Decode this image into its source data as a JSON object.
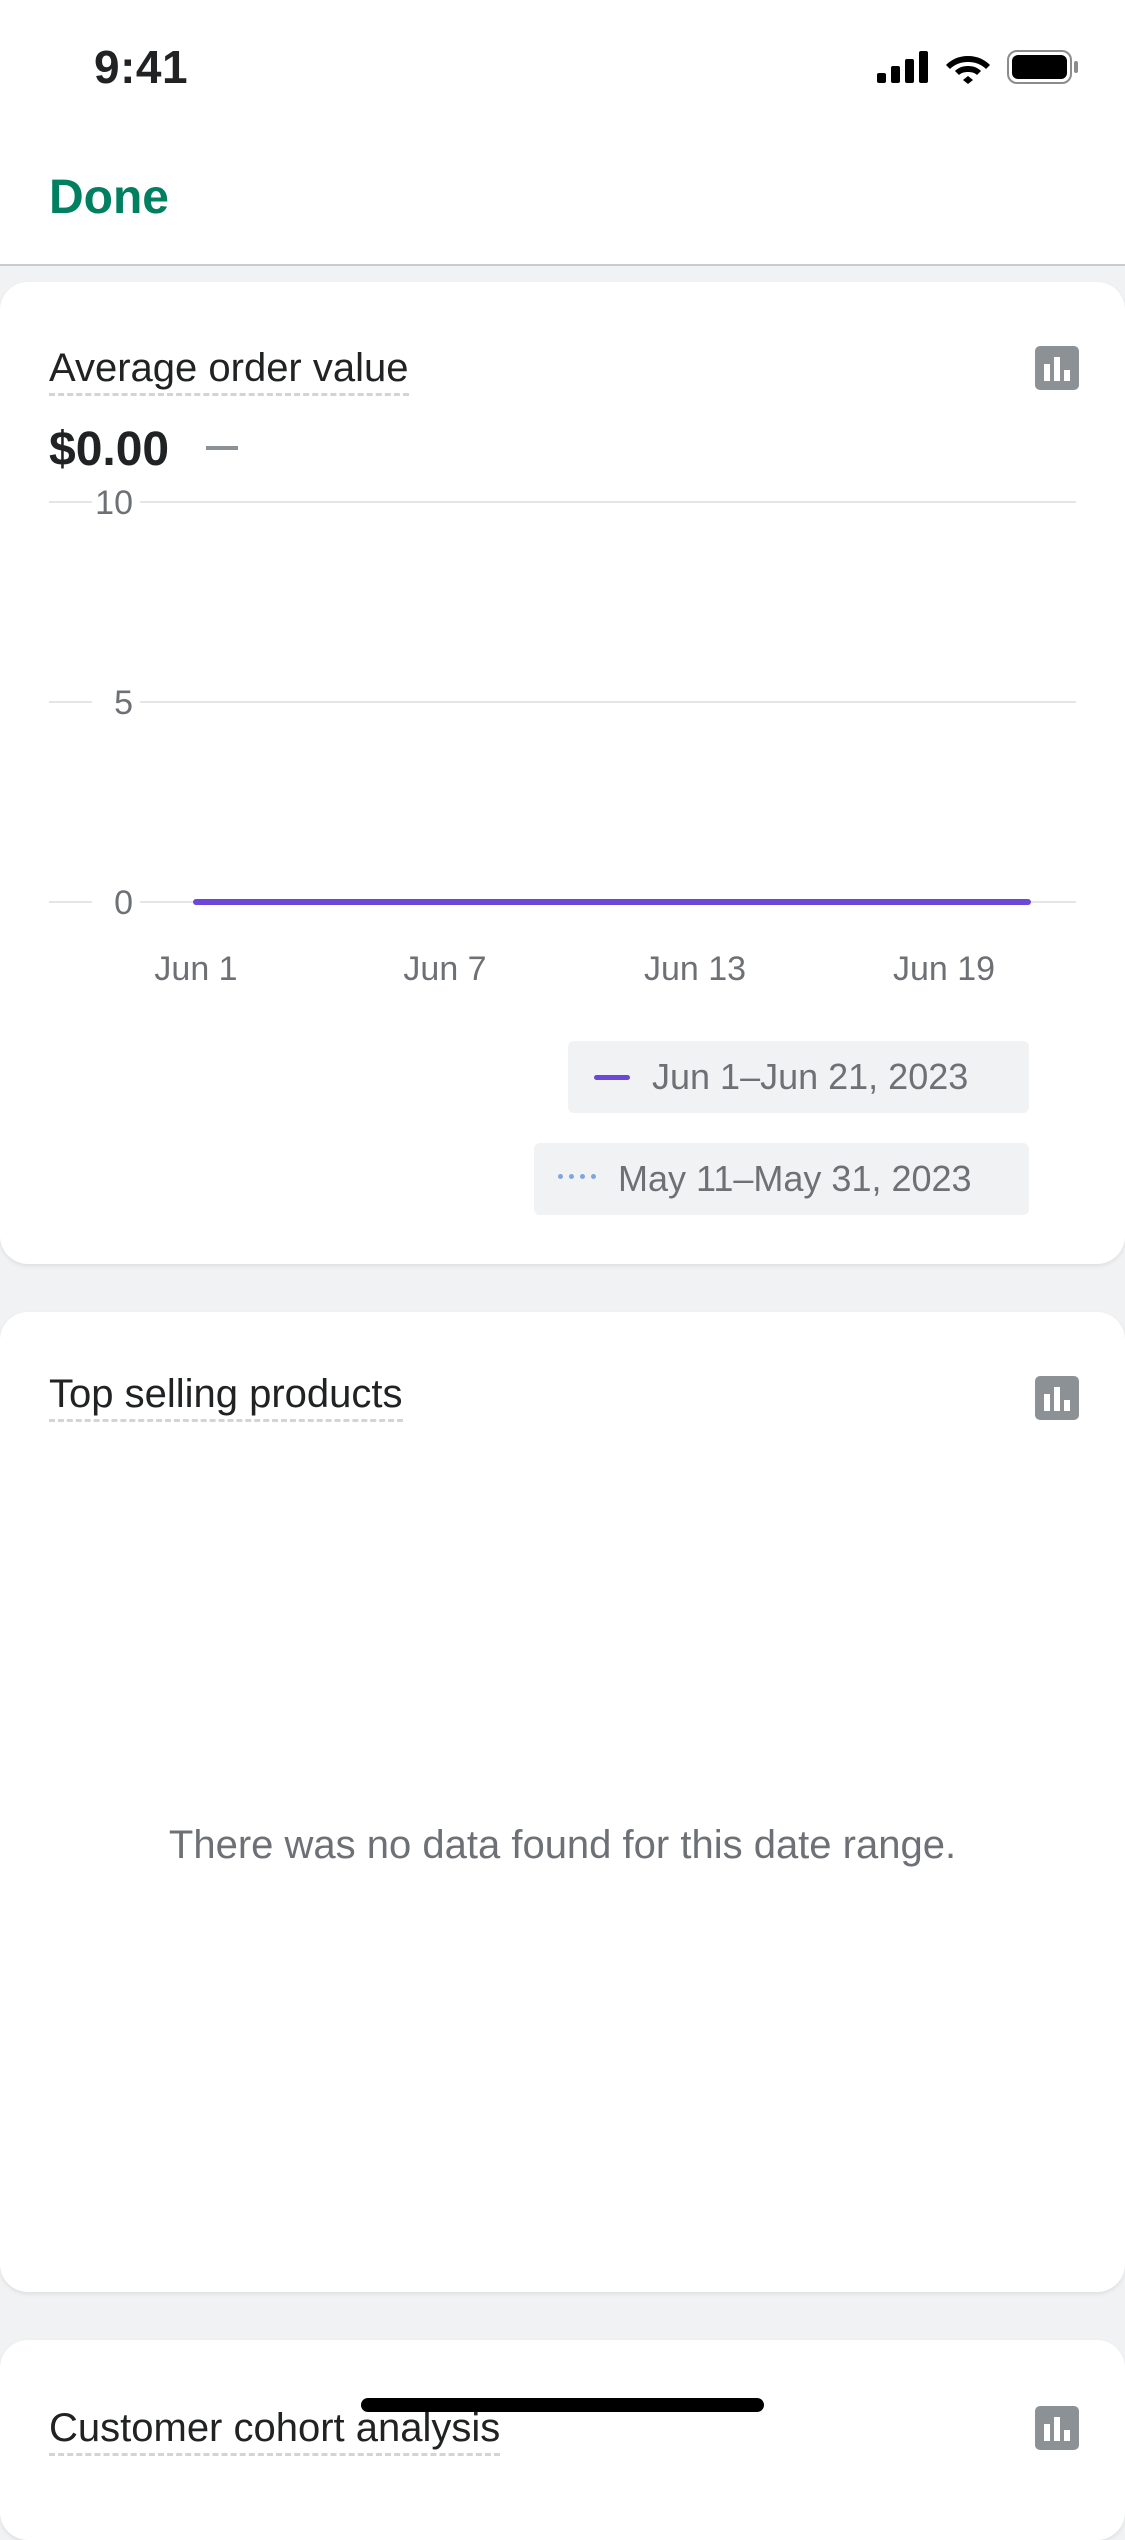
{
  "status_bar": {
    "time": "9:41",
    "icons": [
      "cellular-signal-icon",
      "wifi-icon",
      "battery-icon"
    ]
  },
  "nav": {
    "done_label": "Done"
  },
  "cards": [
    {
      "title": "Average order value",
      "icon": "bar-chart-icon",
      "metric": "$0.00",
      "legend": [
        {
          "label": "Jun 1–Jun 21, 2023",
          "style": "solid",
          "color": "#6c47d8"
        },
        {
          "label": "May 11–May 31, 2023",
          "style": "dotted",
          "color": "#7fa5e3"
        }
      ]
    },
    {
      "title": "Top selling products",
      "icon": "bar-chart-icon",
      "empty_message": "There was no data found for this date range."
    },
    {
      "title": "Customer cohort analysis",
      "icon": "bar-chart-icon"
    }
  ],
  "chart_data": {
    "type": "line",
    "y_ticks": [
      "10",
      "5",
      "0"
    ],
    "x_ticks": [
      "Jun 1",
      "Jun 7",
      "Jun 13",
      "Jun 19"
    ],
    "ylim": [
      0,
      10
    ],
    "grid": true,
    "series": [
      {
        "name": "Jun 1–Jun 21, 2023",
        "x": [
          "Jun 1",
          "Jun 21"
        ],
        "values": [
          0,
          0
        ],
        "color": "#6c47d8"
      }
    ]
  }
}
